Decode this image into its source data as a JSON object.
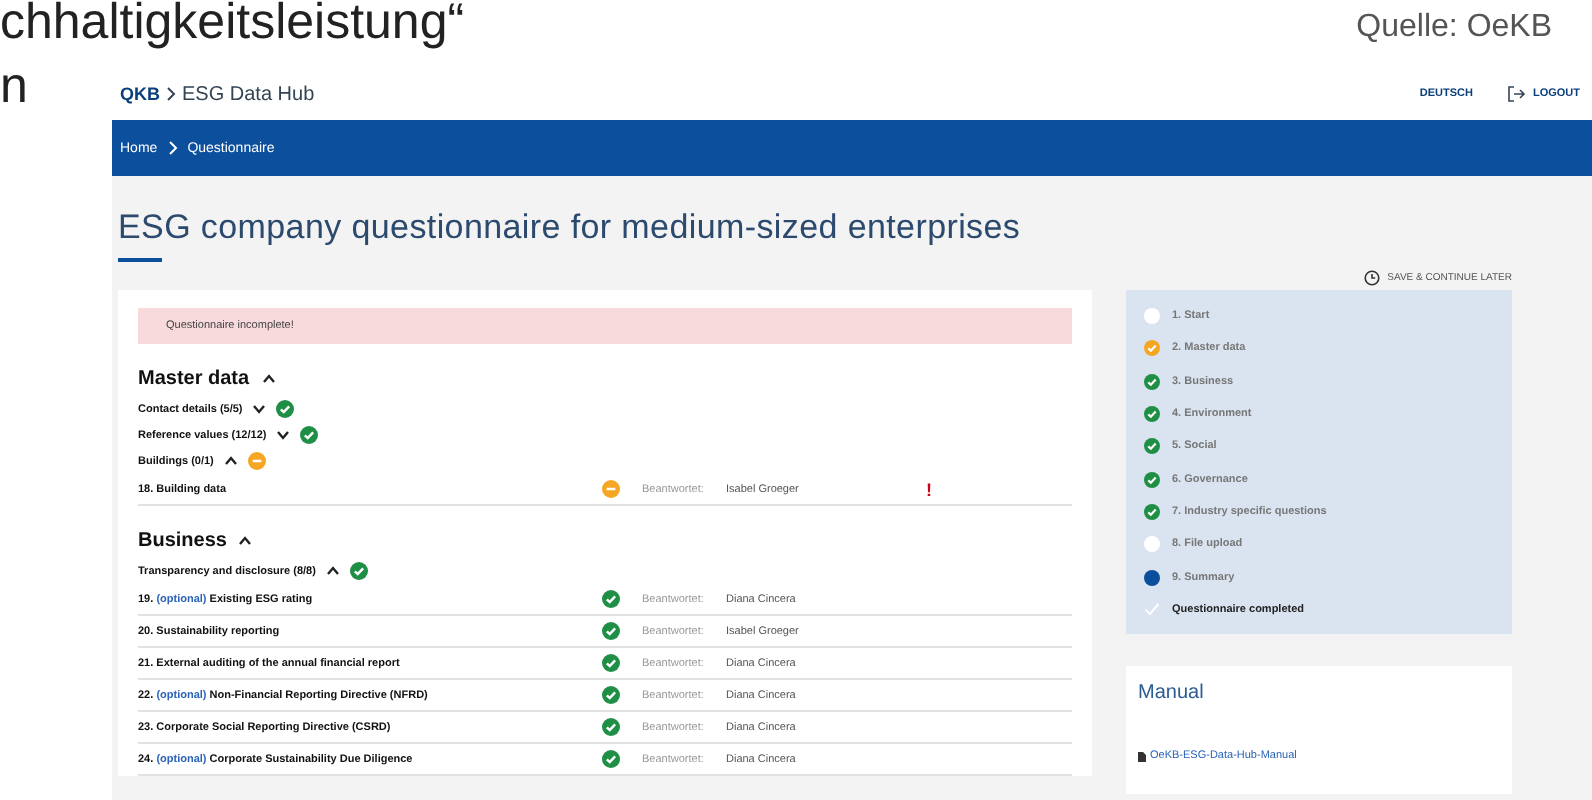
{
  "slide": {
    "title_fragment": "chhaltigkeitsleistung“",
    "second_line_fragment": "n",
    "source": "Quelle: OeKB"
  },
  "app": {
    "logo": "QKB",
    "product": "ESG Data Hub",
    "language": "DEUTSCH",
    "logout": "LOGOUT",
    "breadcrumbs": [
      "Home",
      "Questionnaire"
    ],
    "title": "ESG company questionnaire for medium-sized enterprises",
    "save_later": "SAVE & CONTINUE LATER",
    "alert": "Questionnaire incomplete!",
    "sections": [
      {
        "title": "Master data",
        "expanded": true,
        "groups": [
          {
            "title": "Contact details (5/5)",
            "expanded": false,
            "complete": true
          },
          {
            "title": "Reference values (12/12)",
            "expanded": false,
            "complete": true
          },
          {
            "title": "Buildings (0/1)",
            "expanded": true,
            "complete": false,
            "questions": [
              {
                "number": "18.",
                "title": "Building data",
                "complete": false,
                "answered_label": "Beantwortet:",
                "user": "Isabel Groeger",
                "warning": "!"
              }
            ]
          }
        ]
      },
      {
        "title": "Business",
        "expanded": true,
        "groups": [
          {
            "title": "Transparency and disclosure (8/8)",
            "expanded": true,
            "complete": true,
            "questions": [
              {
                "number": "19.",
                "tag": "(optional)",
                "title": "Existing ESG rating",
                "complete": true,
                "answered_label": "Beantwortet:",
                "user": "Diana Cincera"
              },
              {
                "number": "20.",
                "title": "Sustainability reporting",
                "complete": true,
                "answered_label": "Beantwortet:",
                "user": "Isabel Groeger"
              },
              {
                "number": "21.",
                "title": "External auditing of the annual financial report",
                "complete": true,
                "answered_label": "Beantwortet:",
                "user": "Diana Cincera"
              },
              {
                "number": "22.",
                "tag": "(optional)",
                "title": "Non-Financial Reporting Directive (NFRD)",
                "complete": true,
                "answered_label": "Beantwortet:",
                "user": "Diana Cincera"
              },
              {
                "number": "23.",
                "title": "Corporate Social Reporting Directive (CSRD)",
                "complete": true,
                "answered_label": "Beantwortet:",
                "user": "Diana Cincera"
              },
              {
                "number": "24.",
                "tag": "(optional)",
                "title": "Corporate Sustainability Due Diligence",
                "complete": true,
                "answered_label": "Beantwortet:",
                "user": "Diana Cincera"
              }
            ]
          }
        ]
      }
    ],
    "steps": [
      {
        "label": "1. Start",
        "kind": "open"
      },
      {
        "label": "2. Master data",
        "kind": "partial"
      },
      {
        "label": "3. Business",
        "kind": "done"
      },
      {
        "label": "4. Environment",
        "kind": "done"
      },
      {
        "label": "5. Social",
        "kind": "done"
      },
      {
        "label": "6. Governance",
        "kind": "done"
      },
      {
        "label": "7. Industry specific questions",
        "kind": "done"
      },
      {
        "label": "8. File upload",
        "kind": "open"
      },
      {
        "label": "9. Summary",
        "kind": "current"
      },
      {
        "label": "Questionnaire completed",
        "kind": "final"
      }
    ],
    "manual": {
      "title": "Manual",
      "link": "OeKB-ESG-Data-Hub-Manual"
    }
  }
}
